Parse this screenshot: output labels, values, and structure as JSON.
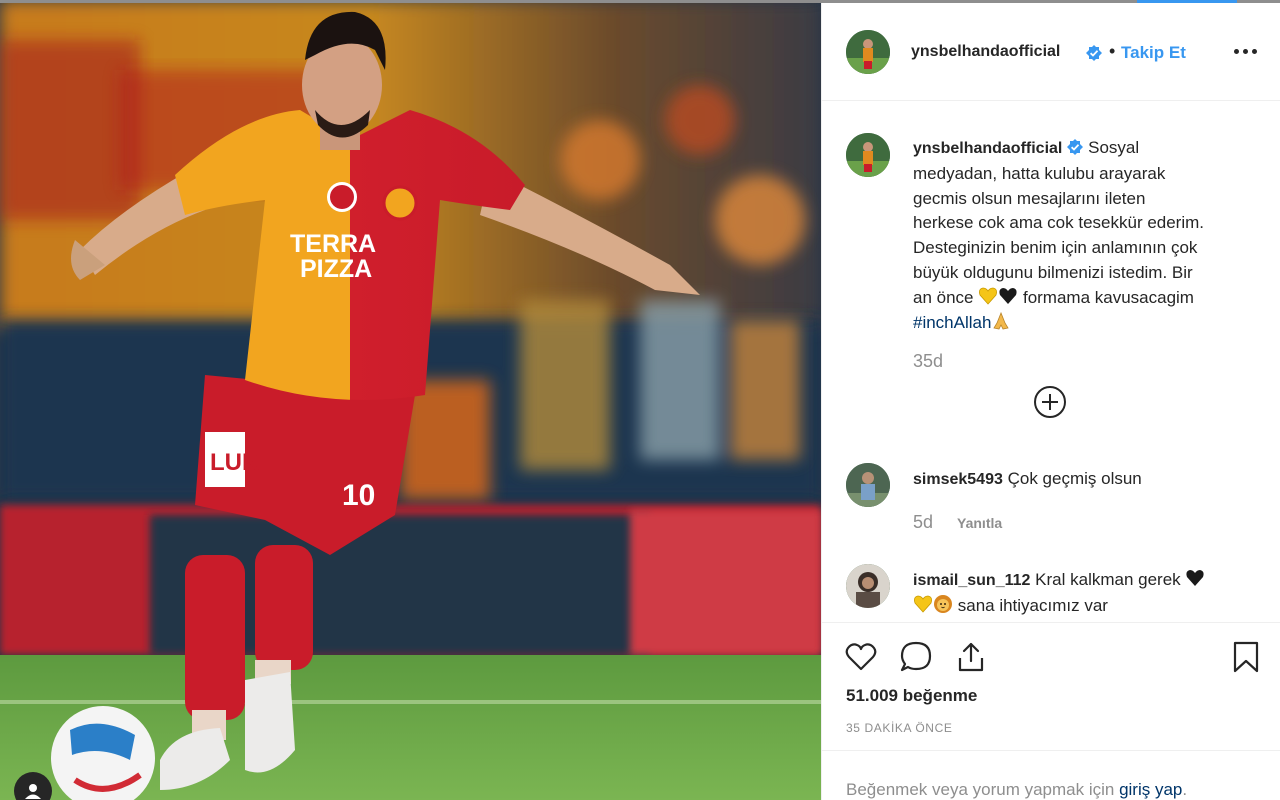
{
  "post": {
    "username": "ynsbelhandaofficial",
    "follow_label": "Takip Et",
    "separator": "•"
  },
  "caption": {
    "username": "ynsbelhandaofficial",
    "line1": "Sosyal",
    "line2": "medyadan, hatta kulubu arayarak",
    "line3": "gecmis olsun mesajlarını ileten",
    "line4": "herkese cok ama cok tesekkür ederim.",
    "line5": "Desteginizin benim için anlamının çok",
    "line6": "büyük oldugunu bilmenizi istedim. Bir",
    "line7_a": "an önce",
    "line7_b": "formama kavusacagim",
    "hashtag": "#inchAllah",
    "time": "35d"
  },
  "comments": [
    {
      "username": "simsek5493",
      "text": "Çok geçmiş olsun",
      "time": "5d",
      "reply_label": "Yanıtla"
    },
    {
      "username": "ismail_sun_112",
      "text_a": "Kral kalkman gerek",
      "text_b": "sana ihtiyacımız var"
    }
  ],
  "actions": {
    "likes": "51.009 beğenme",
    "time": "35 DAKİKA ÖNCE"
  },
  "login": {
    "prefix": "Beğenmek veya yorum yapmak için",
    "link": "giriş yap",
    "suffix": "."
  },
  "icons": {
    "verified": "verified-badge-icon",
    "more": "more-options-icon",
    "load_more": "plus-circle-icon",
    "like": "heart-icon",
    "comment": "comment-icon",
    "share": "share-icon",
    "save": "bookmark-icon",
    "user_tag": "user-tag-icon"
  },
  "colors": {
    "accent": "#3897f0",
    "link": "#003569",
    "muted": "#8e8e8e",
    "text": "#262626"
  }
}
